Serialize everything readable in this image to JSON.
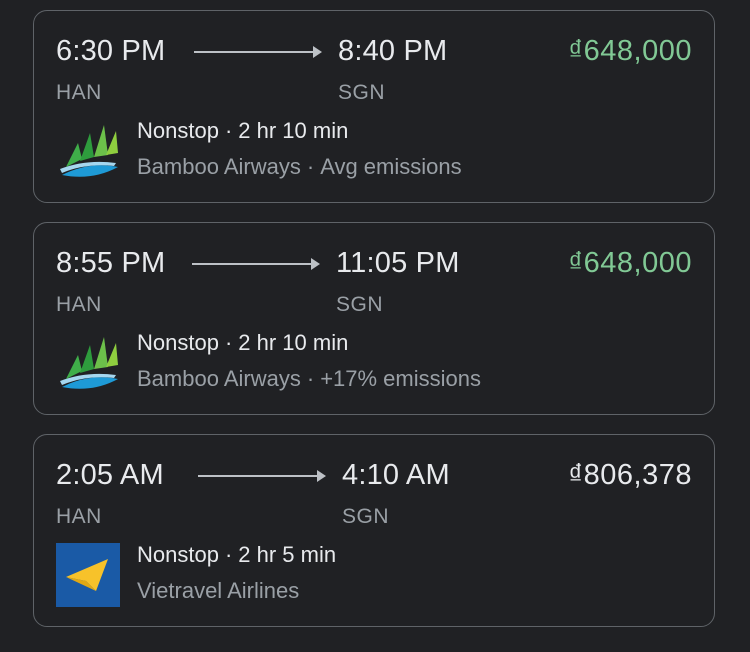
{
  "flights": [
    {
      "depart_time": "6:30 PM",
      "arrive_time": "8:40 PM",
      "depart_code": "HAN",
      "arrive_code": "SGN",
      "price": "₫648,000",
      "price_color": "#81c995",
      "stops": "Nonstop",
      "duration": "2 hr 10 min",
      "airline": "Bamboo Airways",
      "emissions": "Avg emissions",
      "logo_icon": "bamboo-airways-logo-icon"
    },
    {
      "depart_time": "8:55 PM",
      "arrive_time": "11:05 PM",
      "depart_code": "HAN",
      "arrive_code": "SGN",
      "price": "₫648,000",
      "price_color": "#81c995",
      "stops": "Nonstop",
      "duration": "2 hr 10 min",
      "airline": "Bamboo Airways",
      "emissions": "+17% emissions",
      "logo_icon": "bamboo-airways-logo-icon"
    },
    {
      "depart_time": "2:05 AM",
      "arrive_time": "4:10 AM",
      "depart_code": "HAN",
      "arrive_code": "SGN",
      "price": "₫806,378",
      "price_color": "#e8eaed",
      "stops": "Nonstop",
      "duration": "2 hr 5 min",
      "airline": "Vietravel Airlines",
      "logo_icon": "vietravel-airlines-logo-icon"
    }
  ],
  "separator": "·"
}
